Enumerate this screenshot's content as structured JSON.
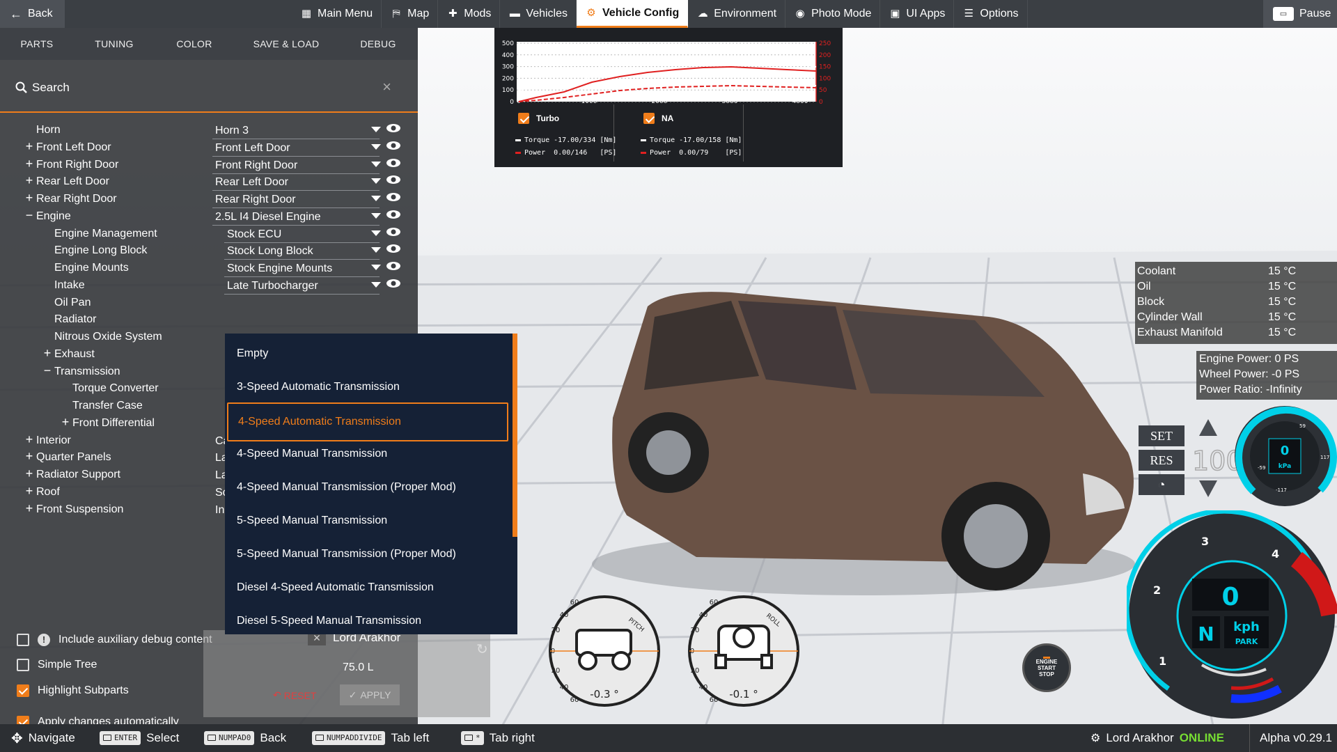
{
  "topbar": {
    "back_label": "Back",
    "menu": [
      {
        "label": "Main Menu",
        "icon": "grid-icon"
      },
      {
        "label": "Map",
        "icon": "map-icon"
      },
      {
        "label": "Mods",
        "icon": "puzzle-icon"
      },
      {
        "label": "Vehicles",
        "icon": "car-icon"
      },
      {
        "label": "Vehicle Config",
        "icon": "engine-icon",
        "active": true
      },
      {
        "label": "Environment",
        "icon": "weather-icon"
      },
      {
        "label": "Photo Mode",
        "icon": "camera-icon"
      },
      {
        "label": "UI Apps",
        "icon": "apps-icon"
      },
      {
        "label": "Options",
        "icon": "sliders-icon"
      }
    ],
    "pause_label": "Pause"
  },
  "panel": {
    "tabs": [
      "PARTS",
      "TUNING",
      "COLOR",
      "SAVE & LOAD",
      "DEBUG"
    ],
    "search_label": "Search",
    "tree": [
      {
        "name": "Horn",
        "value": "Horn 3",
        "level": 0,
        "expander": ""
      },
      {
        "name": "Front Left Door",
        "value": "Front Left Door",
        "level": 0,
        "expander": "+"
      },
      {
        "name": "Front Right Door",
        "value": "Front Right Door",
        "level": 0,
        "expander": "+"
      },
      {
        "name": "Rear Left Door",
        "value": "Rear Left Door",
        "level": 0,
        "expander": "+"
      },
      {
        "name": "Rear Right Door",
        "value": "Rear Right Door",
        "level": 0,
        "expander": "+"
      },
      {
        "name": "Engine",
        "value": "2.5L I4 Diesel Engine",
        "level": 0,
        "expander": "−"
      },
      {
        "name": "Engine Management",
        "value": "Stock ECU",
        "level": 1,
        "expander": ""
      },
      {
        "name": "Engine Long Block",
        "value": "Stock Long Block",
        "level": 1,
        "expander": ""
      },
      {
        "name": "Engine Mounts",
        "value": "Stock Engine Mounts",
        "level": 1,
        "expander": ""
      },
      {
        "name": "Intake",
        "value": "Late Turbocharger",
        "level": 1,
        "expander": ""
      },
      {
        "name": "Oil Pan",
        "value": "",
        "level": 1,
        "expander": ""
      },
      {
        "name": "Radiator",
        "value": "",
        "level": 1,
        "expander": ""
      },
      {
        "name": "Nitrous Oxide System",
        "value": "",
        "level": 1,
        "expander": ""
      },
      {
        "name": "Exhaust",
        "value": "",
        "level": 1,
        "expander": "+"
      },
      {
        "name": "Transmission",
        "value": "",
        "level": 1,
        "expander": "−"
      },
      {
        "name": "Torque Converter",
        "value": "",
        "level": 2,
        "expander": ""
      },
      {
        "name": "Transfer Case",
        "value": "",
        "level": 2,
        "expander": ""
      },
      {
        "name": "Front Differential",
        "value": "",
        "level": 2,
        "expander": "+"
      },
      {
        "name": "Interior",
        "value": "Ca",
        "level": 0,
        "expander": "+"
      },
      {
        "name": "Quarter Panels",
        "value": "La",
        "level": 0,
        "expander": "+"
      },
      {
        "name": "Radiator Support",
        "value": "La",
        "level": 0,
        "expander": "+"
      },
      {
        "name": "Roof",
        "value": "Sc",
        "level": 0,
        "expander": "+"
      },
      {
        "name": "Front Suspension",
        "value": "In",
        "level": 0,
        "expander": "+"
      }
    ],
    "options": [
      {
        "label": "Include auxiliary debug content",
        "checked": false,
        "warn": true
      },
      {
        "label": "Simple Tree",
        "checked": false
      },
      {
        "label": "Highlight Subparts",
        "checked": true
      },
      {
        "label": "Apply changes automatically",
        "checked": true
      }
    ],
    "reset_label": "RESET",
    "apply_label": "APPLY"
  },
  "misc_panel": {
    "user": "Lord Arakhor",
    "fuel_value": "75.0 L"
  },
  "dropdown": {
    "options": [
      "Empty",
      "3-Speed Automatic Transmission",
      "4-Speed Automatic Transmission",
      "4-Speed Manual Transmission",
      "4-Speed Manual Transmission (Proper Mod)",
      "5-Speed Manual Transmission",
      "5-Speed Manual Transmission (Proper Mod)",
      "Diesel 4-Speed Automatic Transmission",
      "Diesel 5-Speed Manual Transmission"
    ],
    "selected_index": 2
  },
  "graph": {
    "y_ticks": [
      "500",
      "400",
      "300",
      "200",
      "100",
      "0"
    ],
    "x_ticks": [
      "0",
      "1000",
      "2000",
      "3000",
      "4000"
    ],
    "right_ticks": [
      "250",
      "200",
      "150",
      "100",
      "50",
      "0"
    ],
    "blocks": [
      {
        "name": "Turbo",
        "torque": "Torque -17.00/334 [Nm]",
        "power": "Power  0.00/146   [PS]"
      },
      {
        "name": "NA",
        "torque": "Torque -17.00/158 [Nm]",
        "power": "Power  0.00/79    [PS]"
      }
    ]
  },
  "temps": [
    {
      "label": "Coolant",
      "value": "15 °C"
    },
    {
      "label": "Oil",
      "value": "15 °C"
    },
    {
      "label": "Block",
      "value": "15 °C"
    },
    {
      "label": "Cylinder Wall",
      "value": "15 °C"
    },
    {
      "label": "Exhaust Manifold",
      "value": "15 °C"
    }
  ],
  "power": {
    "engine": "Engine Power: 0 PS",
    "wheel": "Wheel Power: -0 PS",
    "ratio": "Power Ratio: -Infinity"
  },
  "cruise": {
    "set": "SET",
    "res": "RES",
    "speed": "100"
  },
  "boost": {
    "value": "0",
    "unit": "kPa",
    "right": "117",
    "left": "-59",
    "bottom": "-117",
    "top": "59"
  },
  "speedo": {
    "speed": "0",
    "gear": "N",
    "unit": "kph",
    "park": "PARK",
    "rpm_ticks": [
      "1",
      "2",
      "3",
      "4"
    ]
  },
  "attitude": {
    "pitch": {
      "label": "PITCH",
      "value": "-0.3 °"
    },
    "roll": {
      "label": "ROLL",
      "value": "-0.1 °"
    },
    "ticks": [
      "60",
      "40",
      "20",
      "0",
      "20",
      "40",
      "60"
    ]
  },
  "engine_button": {
    "line1": "ENGINE",
    "line2": "START",
    "line3": "STOP"
  },
  "hints": [
    {
      "key": "",
      "label": "Navigate",
      "icon": "dpad-icon"
    },
    {
      "key": "ENTER",
      "label": "Select"
    },
    {
      "key": "NUMPAD0",
      "label": "Back"
    },
    {
      "key": "NUMPADDIVIDE",
      "label": "Tab left"
    },
    {
      "key": "*",
      "label": "Tab right"
    }
  ],
  "status": {
    "user": "Lord Arakhor",
    "online": "ONLINE",
    "version": "Alpha v0.29.1"
  }
}
